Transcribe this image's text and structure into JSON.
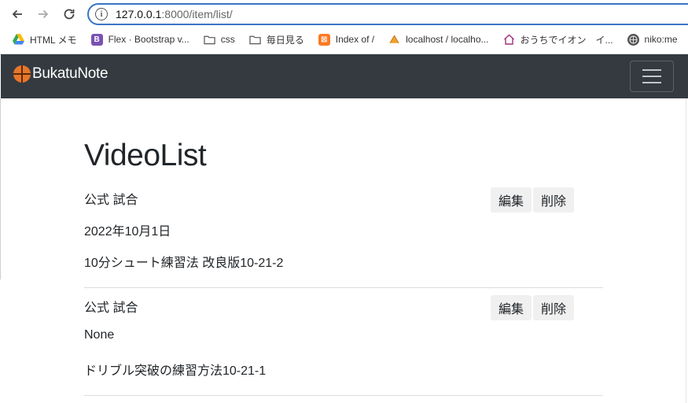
{
  "browser": {
    "url_host": "127.0.0.1",
    "url_path": ":8000/item/list/",
    "bookmarks": [
      {
        "label": "HTML メモ",
        "icon": "drive-icon"
      },
      {
        "label": "Flex · Bootstrap v...",
        "icon": "bootstrap-icon"
      },
      {
        "label": "css",
        "icon": "folder-icon"
      },
      {
        "label": "毎日見る",
        "icon": "folder-icon"
      },
      {
        "label": "Index of /",
        "icon": "xampp-icon"
      },
      {
        "label": "localhost / localho...",
        "icon": "phpmyadmin-icon"
      },
      {
        "label": "おうちでイオン　イ...",
        "icon": "home-icon"
      },
      {
        "label": "niko:me",
        "icon": "globe-icon"
      }
    ]
  },
  "navbar": {
    "brand": "BukatuNote"
  },
  "page": {
    "title": "VideoList"
  },
  "items": [
    {
      "category": "公式 試合",
      "date": "2022年10月1日",
      "name": "10分シュート練習法 改良版10-21-2",
      "edit_label": "編集",
      "delete_label": "削除"
    },
    {
      "category": "公式 試合",
      "date": "None",
      "name": "ドリブル突破の練習方法10-21-1",
      "edit_label": "編集",
      "delete_label": "削除"
    }
  ],
  "colors": {
    "navbar_bg": "#343a40",
    "url_border": "#3b73c6",
    "button_bg": "#f0f0f0"
  }
}
